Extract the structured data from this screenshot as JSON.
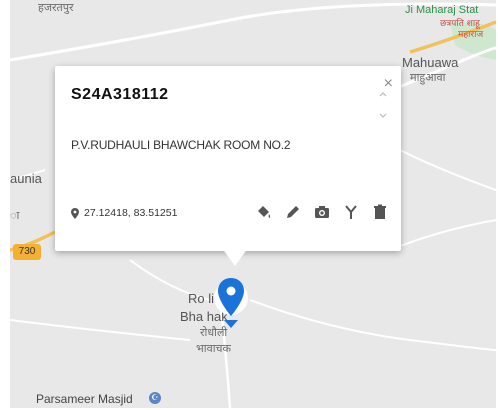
{
  "map": {
    "labels": {
      "top_left_hindi": "हजरतपुर",
      "top_right_en": "Ji Maharaj Stat",
      "top_right_hindi_1": "छत्रपति शाहू",
      "top_right_hindi_2": "महाराज",
      "mahuawa_en": "Mahuawa",
      "mahuawa_hindi": "माहुआवा",
      "left_en": "aunia",
      "left_hindi": "ा",
      "road_badge": "730",
      "center_en_1": "Ro    li",
      "center_en_2": "Bha     hak",
      "center_hindi_1": "रोधौली",
      "center_hindi_2": "भावाचक",
      "bottom_place": "Parsameer Masjid"
    },
    "colors": {
      "land": "#e8e8e8",
      "road_major": "#f3c15a",
      "road_minor": "#ffffff",
      "green_area": "#cfe6cf",
      "pin": "#1a73d9"
    }
  },
  "popup": {
    "title": "S24A318112",
    "description": "P.V.RUDHAULI BHAWCHAK ROOM NO.2",
    "coords": "27.12418, 83.51251",
    "close_icon": "×",
    "tools": [
      "paint-bucket-icon",
      "pencil-icon",
      "camera-icon",
      "fork-icon",
      "trash-icon"
    ]
  }
}
